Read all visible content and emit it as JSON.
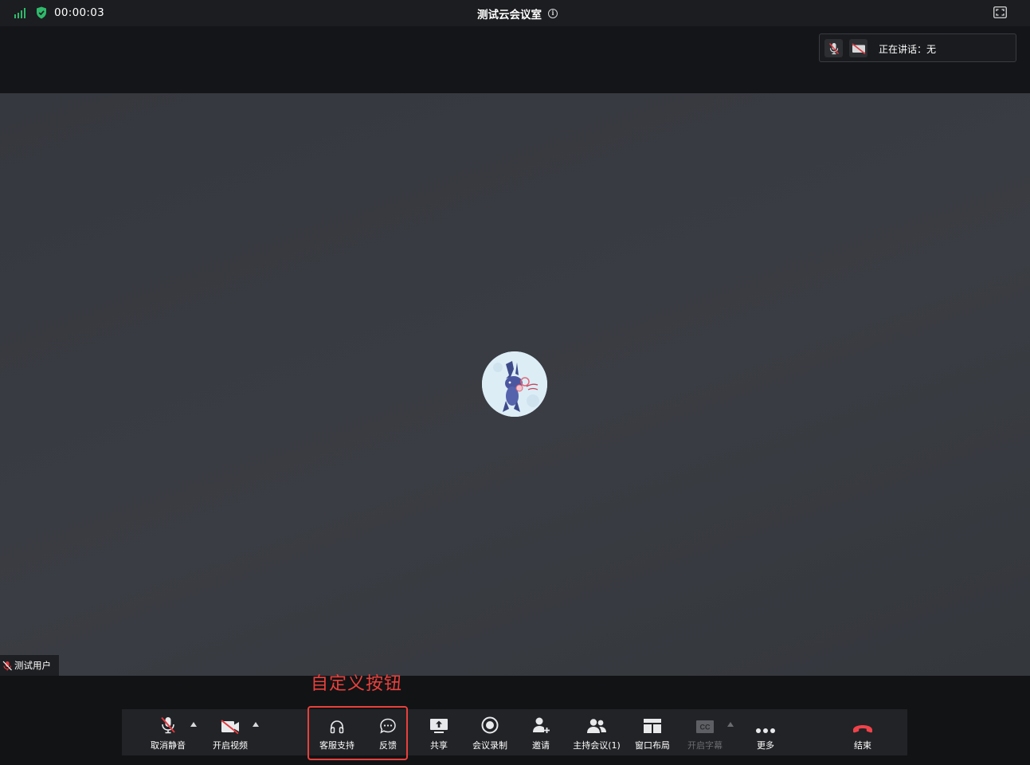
{
  "header": {
    "timer": "00:00:03",
    "title": "测试云会议室",
    "icons": [
      "signal-bars-icon",
      "shield-check-icon",
      "info-icon",
      "fullscreen-icon"
    ]
  },
  "speaking": {
    "text": "正在讲话：无",
    "icons": [
      "mic-off-icon",
      "video-off-icon"
    ]
  },
  "participant": {
    "name": "测试用户",
    "muted": true
  },
  "annotation": {
    "text": "自定义按钮",
    "color": "#e8413c"
  },
  "toolbar": {
    "mute_label": "取消静音",
    "video_label": "开启视频",
    "support_label": "客服支持",
    "feedback_label": "反馈",
    "share_label": "共享",
    "record_label": "会议录制",
    "invite_label": "邀请",
    "host_label": "主持会议(1)",
    "layout_label": "窗口布局",
    "captions_label": "开启字幕",
    "more_label": "更多",
    "end_label": "结束",
    "cc_text": "CC"
  },
  "colors": {
    "accent_green": "#2fb96b",
    "danger_red": "#e8413c",
    "mute_red": "#e0393e"
  }
}
